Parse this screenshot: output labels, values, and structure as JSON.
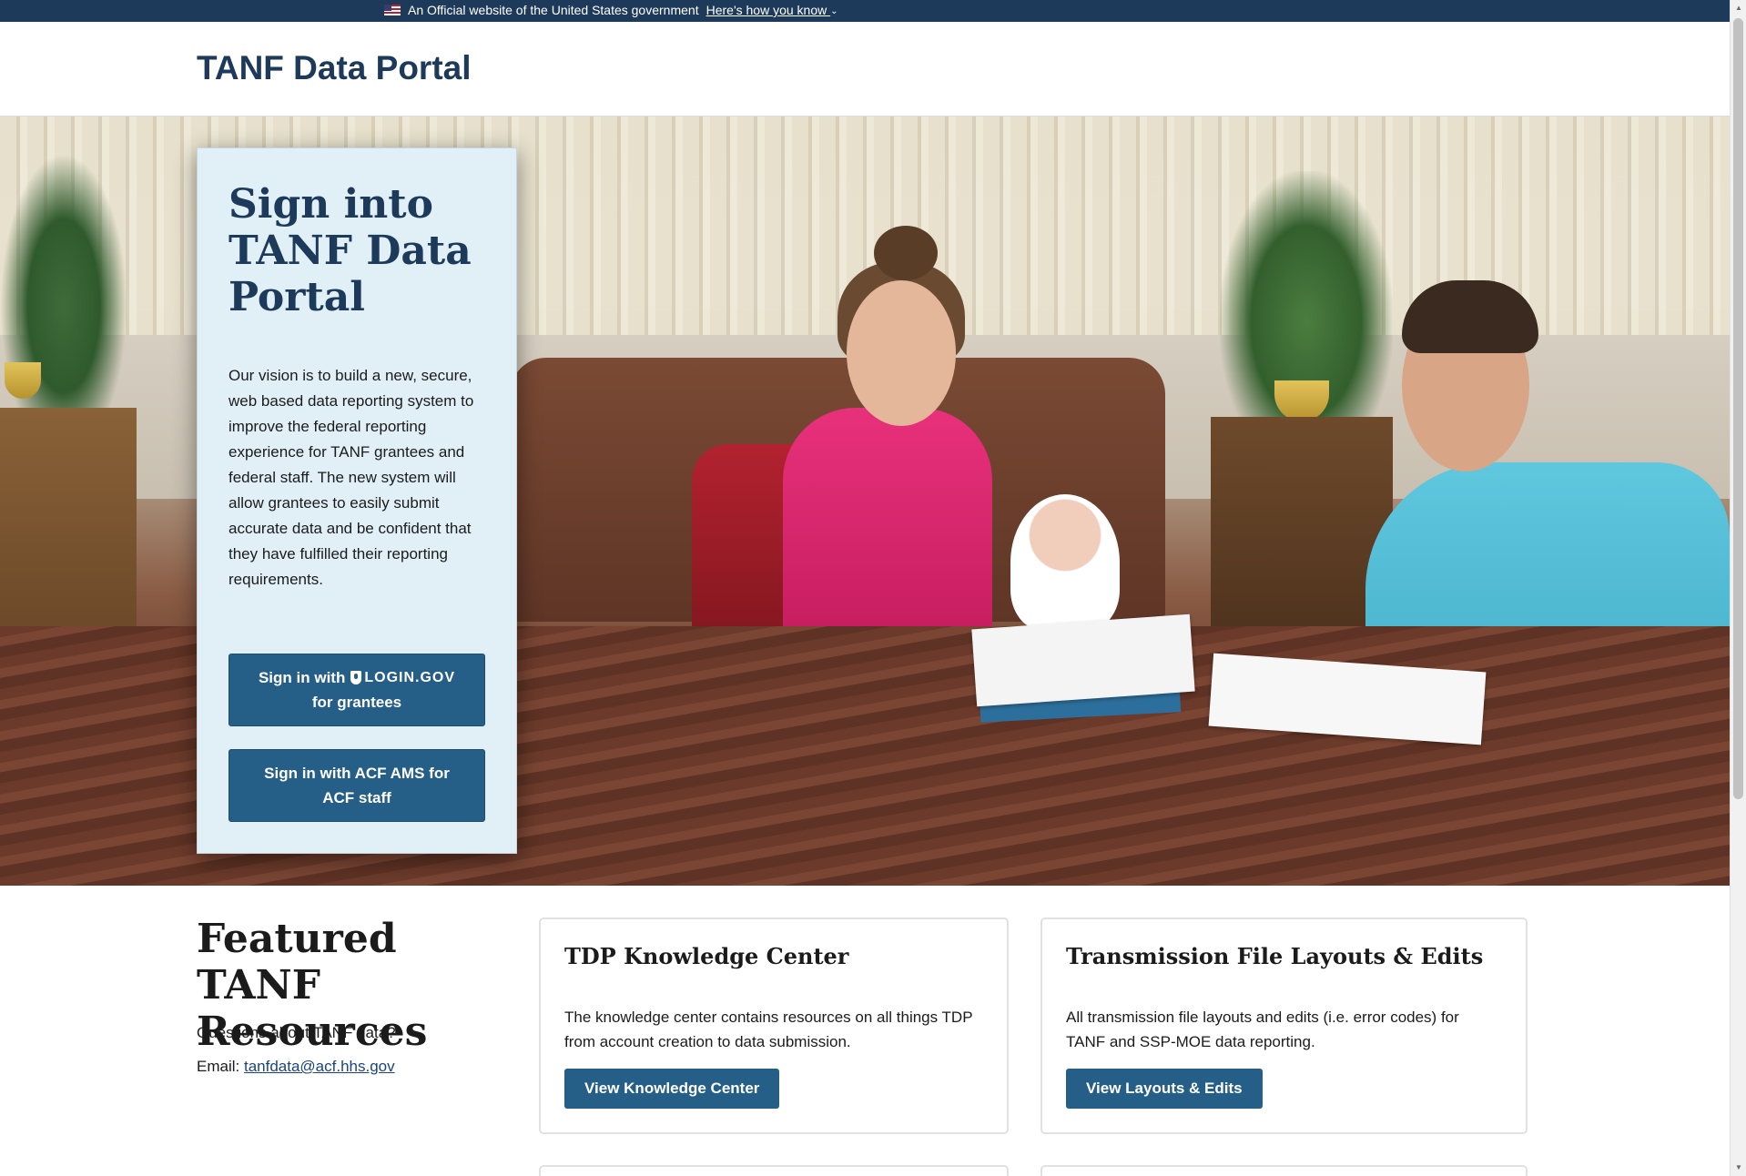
{
  "gov_banner": {
    "text": "An Official website of the United States government",
    "link": "Here's how you know"
  },
  "header": {
    "site_title": "TANF Data Portal"
  },
  "signin": {
    "title": "Sign into TANF Data Portal",
    "description": "Our vision is to build a new, secure, web based data reporting system to improve the federal reporting experience for TANF grantees and federal staff. The new system will allow grantees to easily submit accurate data and be confident that they have fulfilled their reporting requirements.",
    "login_gov_prefix": "Sign in with",
    "login_gov_logo": "LOGIN.GOV",
    "login_gov_suffix": "for grantees",
    "ams_button": "Sign in with ACF AMS for ACF staff"
  },
  "featured": {
    "title": "Featured TANF Resources",
    "question": "Questions about TANF data?",
    "email_label": "Email:",
    "email": "tanfdata@acf.hhs.gov"
  },
  "cards": [
    {
      "title": "TDP Knowledge Center",
      "body": "The knowledge center contains resources on all things TDP from account creation to data submission.",
      "button": "View Knowledge Center"
    },
    {
      "title": "Transmission File Layouts & Edits",
      "body": "All transmission file layouts and edits (i.e. error codes) for TANF and SSP-MOE data reporting.",
      "button": "View Layouts & Edits"
    }
  ],
  "icons": {
    "flag": "us-flag-icon",
    "chevron": "chevron-down-icon",
    "shield": "login-gov-shield-icon"
  },
  "colors": {
    "navy": "#1d3a5a",
    "button": "#255f88",
    "card_bg": "#e1f0f7"
  }
}
